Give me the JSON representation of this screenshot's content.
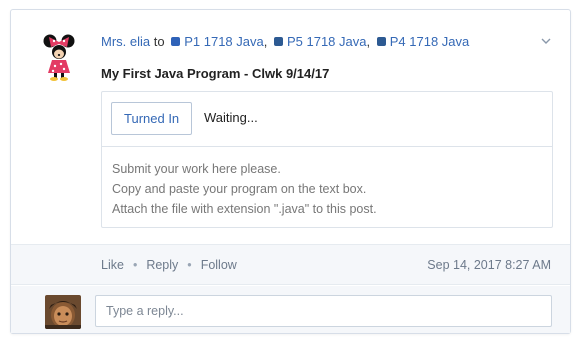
{
  "post": {
    "author": "Mrs. elia",
    "to_word": "to",
    "groups": [
      {
        "name": "P1 1718 Java",
        "color": "#2f62b8",
        "sep": ","
      },
      {
        "name": "P5 1718 Java",
        "color": "#2d5a92",
        "sep": ","
      },
      {
        "name": "P4 1718 Java",
        "color": "#2d5a92",
        "sep": ""
      }
    ],
    "title": "My First Java Program - Clwk 9/14/17",
    "assignment": {
      "status_button": "Turned In",
      "status_text": "Waiting...",
      "instructions": [
        "Submit your work here please.",
        "Copy and paste your program on the text box.",
        "Attach the file with extension \".java\" to this post."
      ]
    },
    "actions": {
      "like": "Like",
      "reply": "Reply",
      "follow": "Follow",
      "separator": "•"
    },
    "timestamp": "Sep 14, 2017 8:27 AM"
  },
  "reply": {
    "placeholder": "Type a reply..."
  },
  "icons": {
    "author_avatar": "minnie-mouse-avatar",
    "user_avatar": "user-photo-avatar",
    "menu": "chevron-down-icon"
  }
}
